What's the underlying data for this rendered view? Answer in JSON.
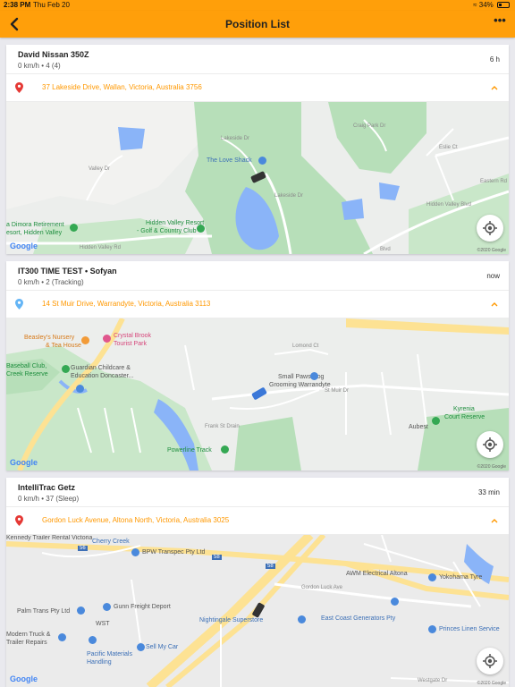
{
  "status_bar": {
    "time": "2:38 PM",
    "date": "Thu Feb 20",
    "battery": "34%",
    "battery_level": 0.34
  },
  "navbar": {
    "title": "Position List",
    "back_icon": "chevron-left-icon",
    "more_icon": "more-dots-icon",
    "more_glyph": "•••"
  },
  "colors": {
    "accent": "#ff9f0a",
    "address": "#ff9800",
    "pin_red": "#e53935",
    "pin_blue": "#64b5f6"
  },
  "map_common": {
    "google": "Google",
    "copyright": "©2020 Google"
  },
  "vehicles": [
    {
      "name": "David Nissan 350Z",
      "status": "0 km/h • 4 (4)",
      "time": "6 h",
      "address": "37 Lakeside Drive, Wallan, Victoria, Australia 3756",
      "pin": "red",
      "map_labels": {
        "love_shack": "The Love Shack",
        "hidden_valley_resort": "Hidden Valley Resort",
        "golf_club": "- Golf & Country Club",
        "dimora": "a Dimora Retirement",
        "dimora2": "esort, Hidden Valley",
        "lakeside": "Lakeside Dr",
        "lakeside2": "Lakeside Dr",
        "valley_dr": "Valley Dr",
        "hidden_valley_rd": "Hidden Valley Rd",
        "hidden_valley_blvd": "Hidden Valley Blvd",
        "eastern_rd": "Eastern Rd",
        "craig_park": "Craig Park Dr",
        "eslie_ct": "Eslie Ct",
        "blvd": "Blvd"
      }
    },
    {
      "name": "IT300 TIME TEST • Sofyan",
      "status": "0 km/h • 2 (Tracking)",
      "time": "now",
      "address": "14 St Muir Drive, Warrandyte, Victoria, Australia 3113",
      "pin": "blue",
      "map_labels": {
        "beasleys": "Beasley's Nursery",
        "tea_house": "& Tea House",
        "crystal_brook": "Crystal Brook",
        "tourist_park": "Tourist Park",
        "baseball": "Baseball Club,",
        "creek_reserve": "Creek Reserve",
        "guardian": "Guardian Childcare &",
        "education": "Education Doncaster...",
        "small_paws": "Small Paws Dog",
        "grooming": "Grooming Warrandyte",
        "kyrenia": "Kyrenia",
        "court_reserve": "Court Reserve",
        "aubest": "Aubest",
        "powerline": "Powerline Track",
        "lomond": "Lomond Ct",
        "st_muir": "St Muir Dr",
        "frank_st": "Frank St Drain"
      }
    },
    {
      "name": "IntelliTrac Getz",
      "status": "0 km/h • 37 (Sleep)",
      "time": "33 min",
      "address": "Gordon Luck Avenue, Altona North, Victoria, Australia 3025",
      "pin": "red",
      "map_labels": {
        "kennedy": "Kennedy Trailer Rental Victoria",
        "cherry_creek": "Cherry Creek",
        "bpw": "BPW Transpec Pty Ltd",
        "awm": "AWM Electrical Altona",
        "yokohama": "Yokohama Tyre",
        "palm": "Palm Trans Pty Ltd",
        "gunn": "Gunn Freight Deport",
        "wst": "WST",
        "nightingale": "Nightingale Superstore",
        "east_coast": "East Coast Generators Pty",
        "modern": "Modern Truck &",
        "trailer": "Trailer Repairs",
        "princes": "Princes Linen Service",
        "pacific": "Pacific Materials",
        "handling": "Handling",
        "sell_my_car": "Sell My Car",
        "gordon_luck": "Gordon Luck Ave",
        "westgate": "Westgate Dr",
        "road_56": "56",
        "road_58": "58"
      }
    }
  ]
}
